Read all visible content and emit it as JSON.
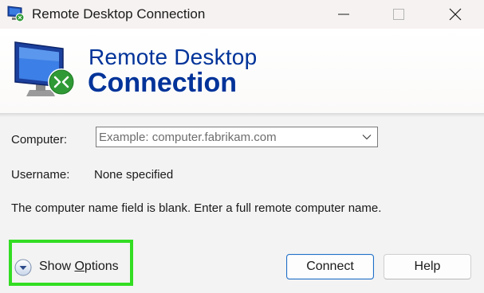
{
  "window": {
    "title": "Remote Desktop Connection",
    "icons": {
      "app": "remote-desktop-icon",
      "minimize": "minimize-icon",
      "maximize": "maximize-icon",
      "close": "close-icon"
    }
  },
  "banner": {
    "line1": "Remote Desktop",
    "line2": "Connection",
    "logo": "remote-desktop-logo",
    "brand_color": "#003399"
  },
  "form": {
    "computer_label": "Computer:",
    "computer_value": "",
    "computer_placeholder": "Example: computer.fabrikam.com",
    "username_label": "Username:",
    "username_value": "None specified",
    "message": "The computer name field is blank. Enter a full remote computer name."
  },
  "footer": {
    "show_options_prefix": "Show ",
    "show_options_underlined": "O",
    "show_options_suffix": "ptions",
    "show_options_icon": "chevron-down-circle-icon",
    "connect_label": "Connect",
    "help_label": "Help",
    "highlight_color": "#33dd22"
  }
}
